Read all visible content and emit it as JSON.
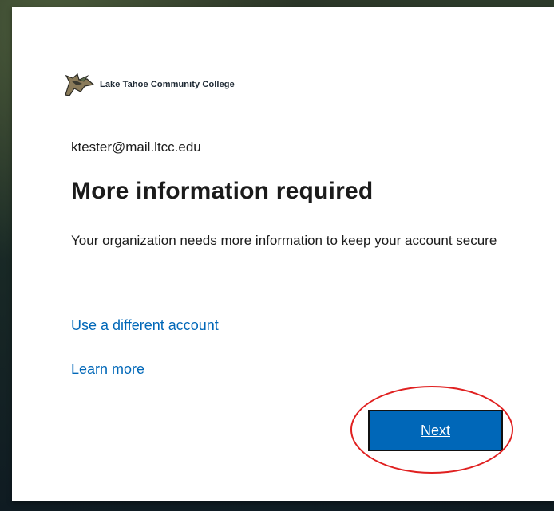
{
  "org": {
    "name": "Lake Tahoe Community College",
    "logo_icon": "ltcc-logo-icon"
  },
  "account": {
    "email": "ktester@mail.ltcc.edu"
  },
  "main": {
    "title": "More information required",
    "description": "Your organization needs more information to keep your account secure"
  },
  "links": {
    "use_different_account": "Use a different account",
    "learn_more": "Learn more"
  },
  "actions": {
    "next_label": "Next"
  },
  "annotation": {
    "color": "#e02020"
  },
  "colors": {
    "link": "#0067b8",
    "primary_button": "#0067b8"
  }
}
